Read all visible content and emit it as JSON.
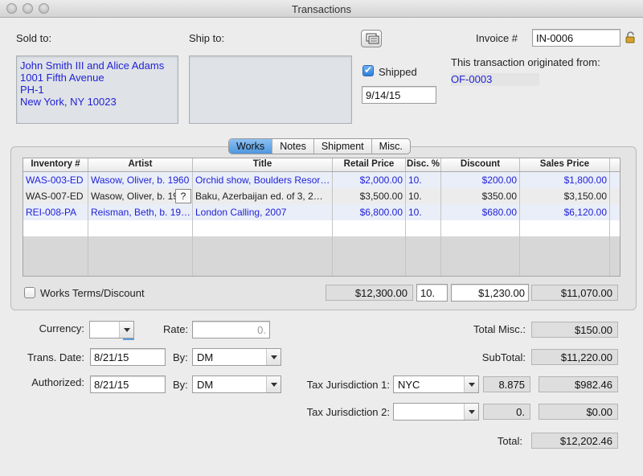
{
  "window": {
    "title": "Transactions"
  },
  "sold_to": {
    "label": "Sold to:",
    "address": "John Smith III and Alice Adams\n1001 Fifth Avenue\nPH-1\nNew York, NY 10023"
  },
  "ship_to": {
    "label": "Ship to:",
    "address": ""
  },
  "invoice": {
    "label": "Invoice #",
    "value": "IN-0006"
  },
  "shipped": {
    "label": "Shipped",
    "checked": true,
    "date": "9/14/15"
  },
  "origin": {
    "label": "This transaction originated from:",
    "value": "OF-0003"
  },
  "tabs": [
    "Works",
    "Notes",
    "Shipment",
    "Misc."
  ],
  "table": {
    "headers": [
      "Inventory #",
      "Artist",
      "Title",
      "Retail Price",
      "Disc. %",
      "Discount",
      "Sales Price"
    ],
    "rows": [
      [
        "WAS-003-ED",
        "Wasow, Oliver, b. 1960",
        "Orchid show, Boulders Resor…",
        "$2,000.00",
        "10.",
        "$200.00",
        "$1,800.00"
      ],
      [
        "WAS-007-ED",
        "Wasow, Oliver, b. 19…",
        "Baku, Azerbaijan ed. of 3, 2…",
        "$3,500.00",
        "10.",
        "$350.00",
        "$3,150.00"
      ],
      [
        "REI-008-PA",
        "Reisman, Beth, b. 19…",
        "London Calling, 2007",
        "$6,800.00",
        "10.",
        "$680.00",
        "$6,120.00"
      ]
    ],
    "help_glyph": "?"
  },
  "works_terms": {
    "label": "Works Terms/Discount",
    "checked": false,
    "retail_total": "$12,300.00",
    "disc_pct": "10.",
    "discount_total": "$1,230.00",
    "sales_total": "$11,070.00"
  },
  "currency": {
    "label": "Currency:",
    "value": ""
  },
  "rate": {
    "label": "Rate:",
    "value": "0."
  },
  "trans_date": {
    "label": "Trans. Date:",
    "value": "8/21/15",
    "by_label": "By:",
    "by_value": "DM"
  },
  "authorized": {
    "label": "Authorized:",
    "value": "8/21/15",
    "by_label": "By:",
    "by_value": "DM"
  },
  "total_misc": {
    "label": "Total Misc.:",
    "value": "$150.00"
  },
  "subtotal": {
    "label": "SubTotal:",
    "value": "$11,220.00"
  },
  "tax1": {
    "label": "Tax Jurisdiction 1:",
    "jurisdiction": "NYC",
    "rate": "8.875",
    "amount": "$982.46"
  },
  "tax2": {
    "label": "Tax Jurisdiction 2:",
    "jurisdiction": "",
    "rate": "0.",
    "amount": "$0.00"
  },
  "total": {
    "label": "Total:",
    "value": "$12,202.46"
  },
  "icons": {
    "lock": "lock-icon",
    "copy_address": "copy-address-icon"
  }
}
